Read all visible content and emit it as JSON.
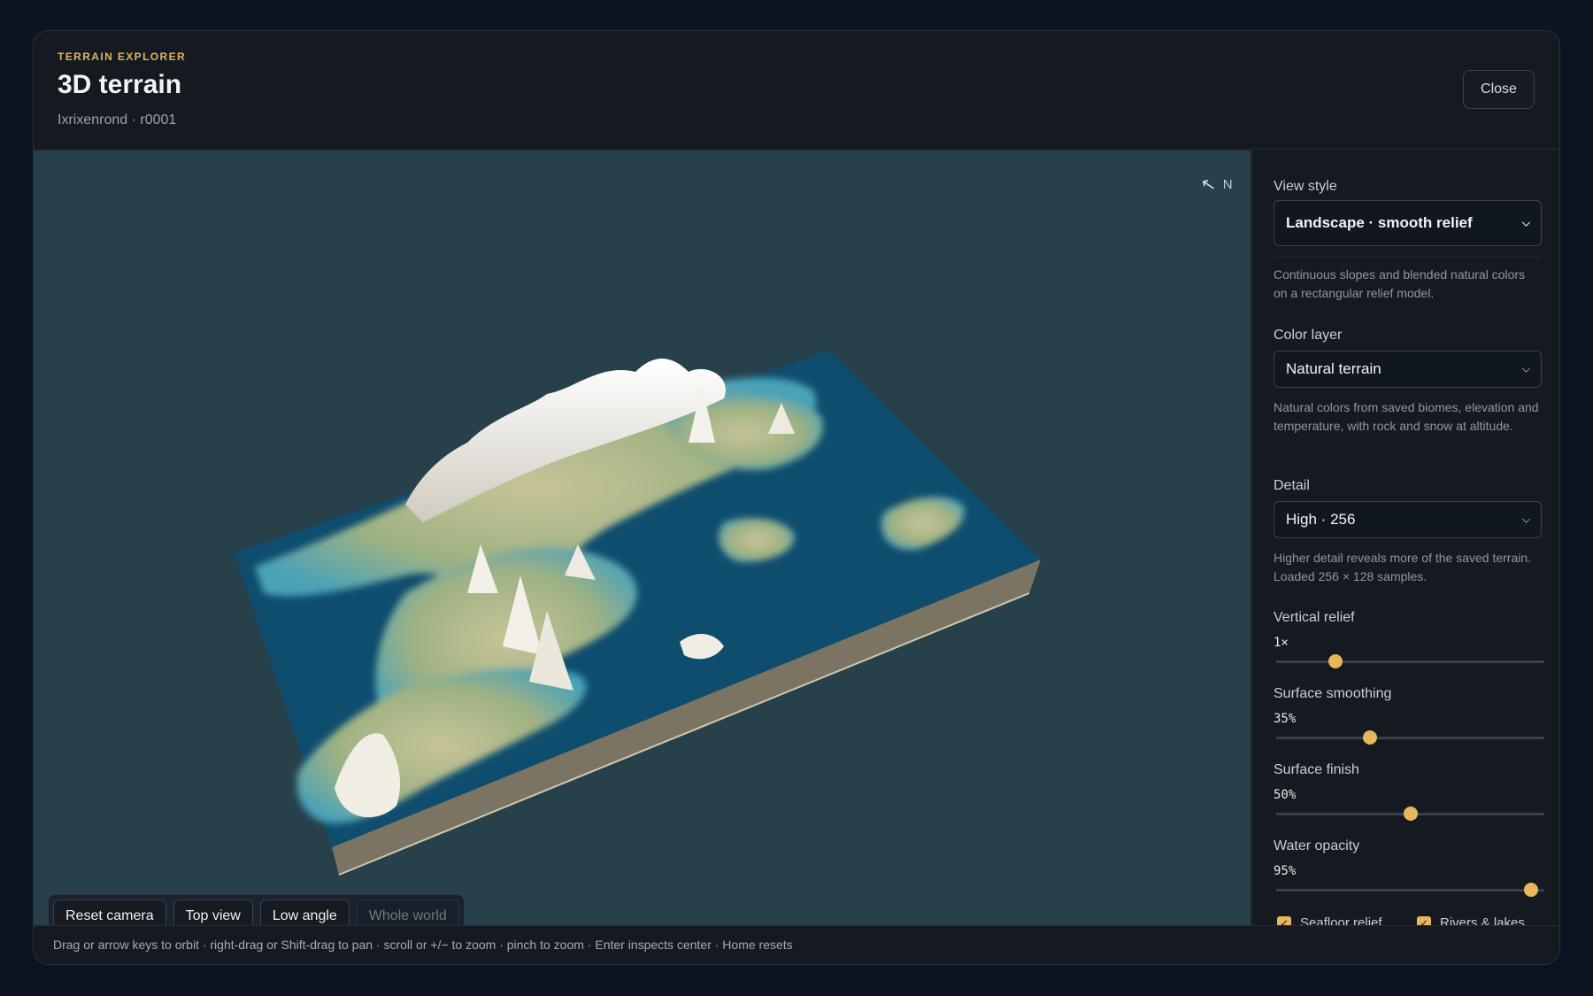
{
  "header": {
    "eyebrow": "TERRAIN EXPLORER",
    "title": "3D terrain",
    "subtitle": "Ixrixenrond · r0001",
    "close_label": "Close"
  },
  "viewport": {
    "compass_label": "N",
    "camera_buttons": [
      {
        "label": "Reset camera",
        "enabled": true
      },
      {
        "label": "Top view",
        "enabled": true
      },
      {
        "label": "Low angle",
        "enabled": true
      },
      {
        "label": "Whole world",
        "enabled": false
      }
    ]
  },
  "panel": {
    "view_style": {
      "label": "View style",
      "selected": "Landscape · smooth relief",
      "description": "Continuous slopes and blended natural colors on a rectangular relief model."
    },
    "color_layer": {
      "label": "Color layer",
      "selected": "Natural terrain",
      "description": "Natural colors from saved biomes, elevation and temperature, with rock and snow at altitude."
    },
    "detail": {
      "label": "Detail",
      "selected": "High · 256",
      "description": "Higher detail reveals more of the saved terrain. Loaded 256 × 128 samples."
    },
    "sliders": [
      {
        "label": "Vertical relief",
        "value_text": "1×",
        "fraction": 0.22
      },
      {
        "label": "Surface smoothing",
        "value_text": "35%",
        "fraction": 0.35
      },
      {
        "label": "Surface finish",
        "value_text": "50%",
        "fraction": 0.5
      },
      {
        "label": "Water opacity",
        "value_text": "95%",
        "fraction": 0.95
      }
    ],
    "checkboxes": [
      {
        "label": "Seafloor relief",
        "checked": true
      },
      {
        "label": "Rivers & lakes",
        "checked": true
      }
    ]
  },
  "footer": {
    "hint": "Drag or arrow keys to orbit · right-drag or Shift-drag to pan · scroll or +/− to zoom · pinch to zoom · Enter inspects center · Home resets"
  },
  "colors": {
    "accent": "#e8b75c",
    "viewport_bg": "#27414b",
    "ocean": "#0e4d6e",
    "land": "#b9b98c",
    "snow": "#eceae3",
    "slab_side": "#7b7462"
  }
}
